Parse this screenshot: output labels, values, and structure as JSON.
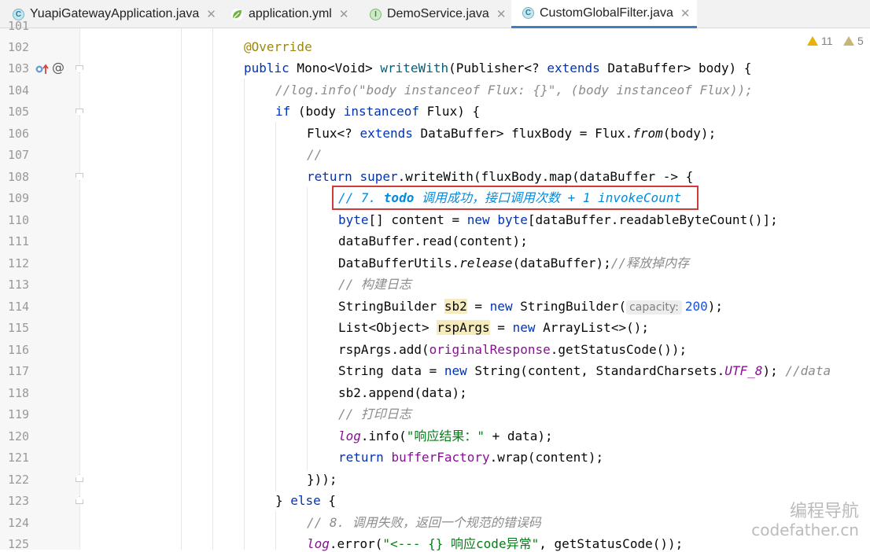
{
  "tabs": [
    {
      "label": "YuapiGatewayApplication.java",
      "icon": "spring-boot-class-icon",
      "active": false
    },
    {
      "label": "application.yml",
      "icon": "spring-yaml-icon",
      "active": false
    },
    {
      "label": "DemoService.java",
      "icon": "interface-icon",
      "active": false
    },
    {
      "label": "CustomGlobalFilter.java",
      "icon": "class-icon",
      "active": true
    }
  ],
  "close_glyph": "✕",
  "inspections": {
    "warnings": "11",
    "weak_warnings": "5"
  },
  "line_numbers": [
    "101",
    "102",
    "103",
    "104",
    "105",
    "106",
    "107",
    "108",
    "109",
    "110",
    "111",
    "112",
    "113",
    "114",
    "115",
    "116",
    "117",
    "118",
    "119",
    "120",
    "121",
    "122",
    "123",
    "124",
    "125"
  ],
  "code": {
    "l102": "@Override",
    "l103": {
      "a": "public",
      "b": " Mono<Void> ",
      "c": "writeWith",
      "d": "(Publisher<? ",
      "e": "extends",
      "f": " DataBuffer> body) {"
    },
    "l104": "//log.info(\"body instanceof Flux: {}\", (body instanceof Flux));",
    "l105": {
      "a": "if",
      "b": " (body ",
      "c": "instanceof",
      "d": " Flux) {"
    },
    "l106": {
      "a": "Flux<? ",
      "b": "extends",
      "c": " DataBuffer> fluxBody = Flux.",
      "d": "from",
      "e": "(body);"
    },
    "l107": "//",
    "l108": {
      "a": "return",
      "b": " ",
      "c": "super",
      "d": ".writeWith(fluxBody.map(dataBuffer -> {"
    },
    "l109": {
      "a": "// 7. ",
      "b": "todo",
      "c": " 调用成功，接口调用次数 + 1 invokeCount"
    },
    "l110": {
      "a": "byte",
      "b": "[] content = ",
      "c": "new",
      "d": " ",
      "e": "byte",
      "f": "[dataBuffer.readableByteCount()];"
    },
    "l111": "dataBuffer.read(content);",
    "l112": {
      "a": "DataBufferUtils.",
      "b": "release",
      "c": "(dataBuffer);",
      "d": "//释放掉内存"
    },
    "l113": "// 构建日志",
    "l114": {
      "a": "StringBuilder ",
      "b": "sb2",
      "c": " = ",
      "d": "new",
      "e": " StringBuilder(",
      "hint": "capacity:",
      "f": "200",
      "g": ");"
    },
    "l115": {
      "a": "List<Object> ",
      "b": "rspArgs",
      "c": " = ",
      "d": "new",
      "e": " ArrayList<>();"
    },
    "l116": {
      "a": "rspArgs.add(",
      "b": "originalResponse",
      "c": ".getStatusCode());"
    },
    "l117": {
      "a": "String data = ",
      "b": "new",
      "c": " String(content, StandardCharsets.",
      "d": "UTF_8",
      "e": "); ",
      "f": "//data"
    },
    "l118": "sb2.append(data);",
    "l119": "// 打印日志",
    "l120": {
      "a": "log",
      "b": ".info(",
      "c": "\"响应结果：\"",
      "d": " + data);"
    },
    "l121": {
      "a": "return",
      "b": " ",
      "c": "bufferFactory",
      "d": ".wrap(content);"
    },
    "l122": "}));",
    "l123": {
      "a": "} ",
      "b": "else",
      "c": " {"
    },
    "l124": "// 8. 调用失败，返回一个规范的错误码",
    "l125": {
      "a": "log",
      "b": ".error(",
      "c": "\"<--- {} 响应code异常\"",
      "d": ", getStatusCode());"
    }
  },
  "watermark": {
    "line1": "编程导航",
    "line2": "codefather.cn"
  }
}
